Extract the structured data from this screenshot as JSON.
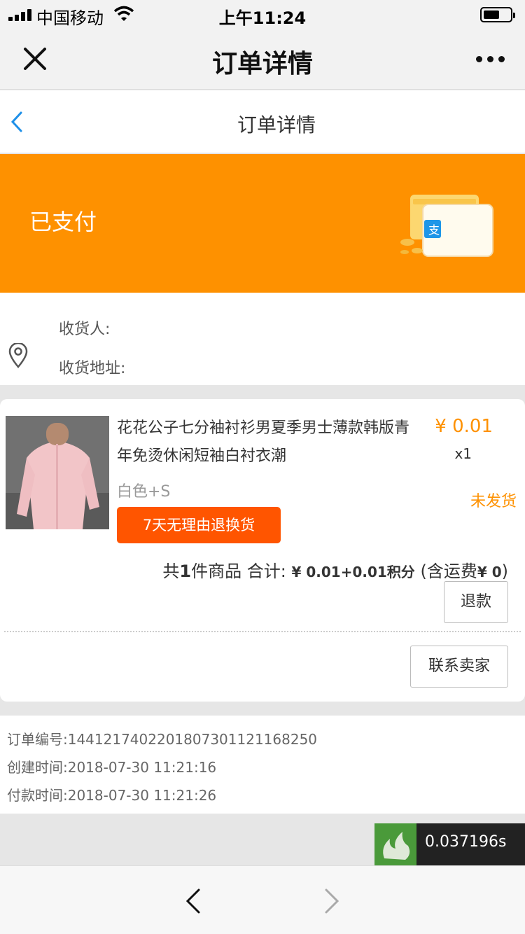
{
  "status_bar": {
    "carrier": "中国移动",
    "time": "上午11:24"
  },
  "top_bar": {
    "title": "订单详情",
    "close_icon": "close-icon",
    "more_icon": "more-icon"
  },
  "nav": {
    "title": "订单详情",
    "back_icon": "chevron-left-icon"
  },
  "banner": {
    "status": "已支付",
    "illustration": "wallet-icon",
    "color": "#fe9100"
  },
  "address": {
    "receiver_label": "收货人:",
    "address_label": "收货地址:",
    "icon": "location-pin-icon"
  },
  "order_item": {
    "name": "花花公子七分袖衬衫男夏季男士薄款韩版青年免烫休闲短袖白衬衣潮",
    "price": "¥ 0.01",
    "quantity": "x1",
    "spec": "白色+S",
    "ship_status": "未发货",
    "return_tag": "7天无理由退换货",
    "total_prefix": "共",
    "total_count": "1",
    "total_mid": "件商品 合计:",
    "total_amount": "¥ 0.01+0.01积分",
    "total_suffix": "(含运费",
    "shipping_fee": "¥ 0",
    "total_close": ")",
    "refund_label": "退款",
    "contact_label": "联系卖家"
  },
  "order_info": {
    "order_no": "订单编号:1441217402201807301121168250",
    "created": "创建时间:2018-07-30 11:21:16",
    "paid": "付款时间:2018-07-30 11:21:26"
  },
  "timer": {
    "value": "0.037196s"
  },
  "bottom_bar": {
    "back_icon": "chevron-left-icon",
    "forward_icon": "chevron-right-icon"
  },
  "colors": {
    "accent_orange": "#fe9100",
    "return_red": "#ff5500"
  }
}
